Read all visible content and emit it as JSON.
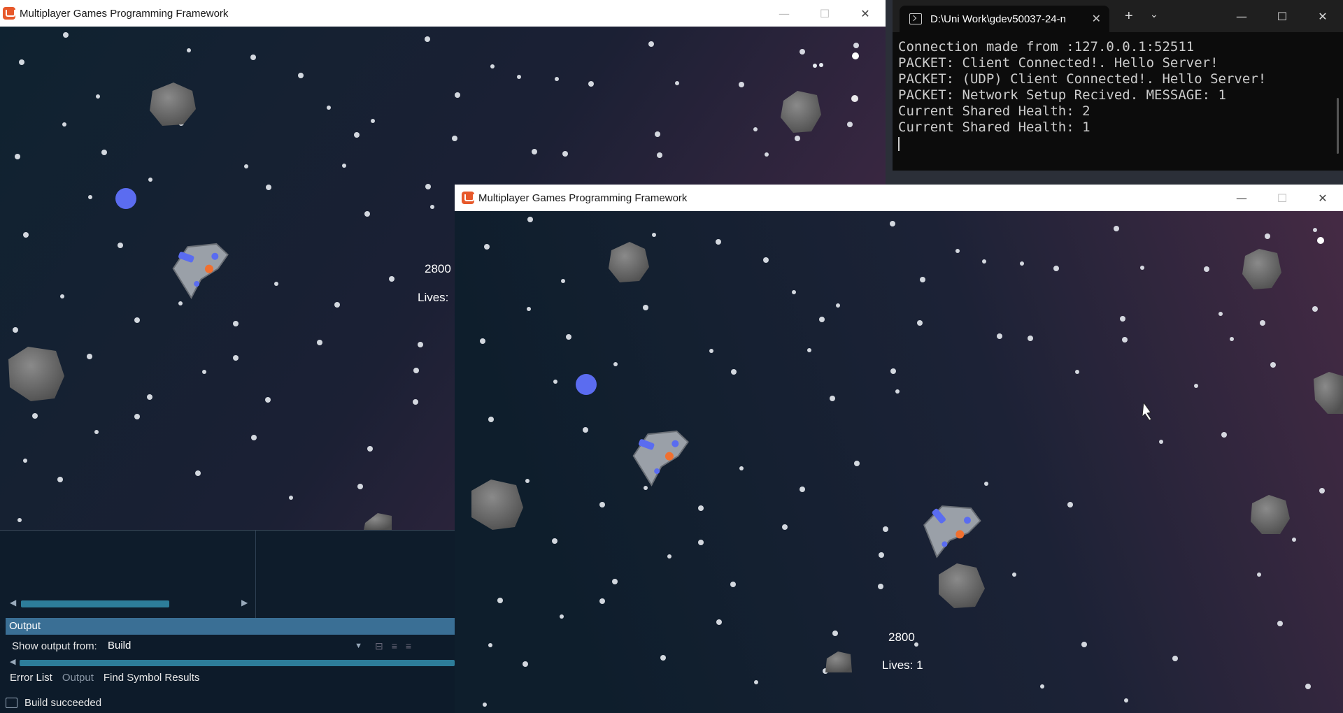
{
  "back_window": {
    "title": "Multiplayer Games Programming Framework",
    "controls": {
      "minimize": "—",
      "maximize": "☐",
      "close": "✕"
    },
    "score": "2800",
    "lives_label": "Lives: "
  },
  "front_window": {
    "title": "Multiplayer Games Programming Framework",
    "controls": {
      "minimize": "—",
      "maximize": "☐",
      "close": "✕"
    },
    "score": "2800",
    "lives_label": "Lives: 1"
  },
  "terminal": {
    "tab_title": "D:\\Uni Work\\gdev50037-24-n",
    "tab_close": "✕",
    "new_tab": "+",
    "dropdown": "⌄",
    "controls": {
      "minimize": "—",
      "maximize": "☐",
      "close": "✕"
    },
    "lines": [
      "Connection made from :127.0.0.1:52511",
      "PACKET: Client Connected!. Hello Server!",
      "PACKET: (UDP) Client Connected!. Hello Server!",
      "PACKET: Network Setup Recived. MESSAGE: 1",
      "Current Shared Health: 2",
      "Current Shared Health: 1"
    ]
  },
  "vs_panel": {
    "output_header": "Output",
    "show_output_from_label": "Show output from:",
    "show_output_from_value": "Build",
    "tabs": [
      "Error List",
      "Output",
      "Find Symbol Results"
    ],
    "active_tab": "Output",
    "status_text": "Build succeeded"
  },
  "colors": {
    "space_dark": "#0f1e2c",
    "space_purple": "#3a2540",
    "terminal_bg": "#0c0c0c",
    "vs_panel_bg": "#0d1b2a",
    "vs_accent": "#3a6f95"
  }
}
